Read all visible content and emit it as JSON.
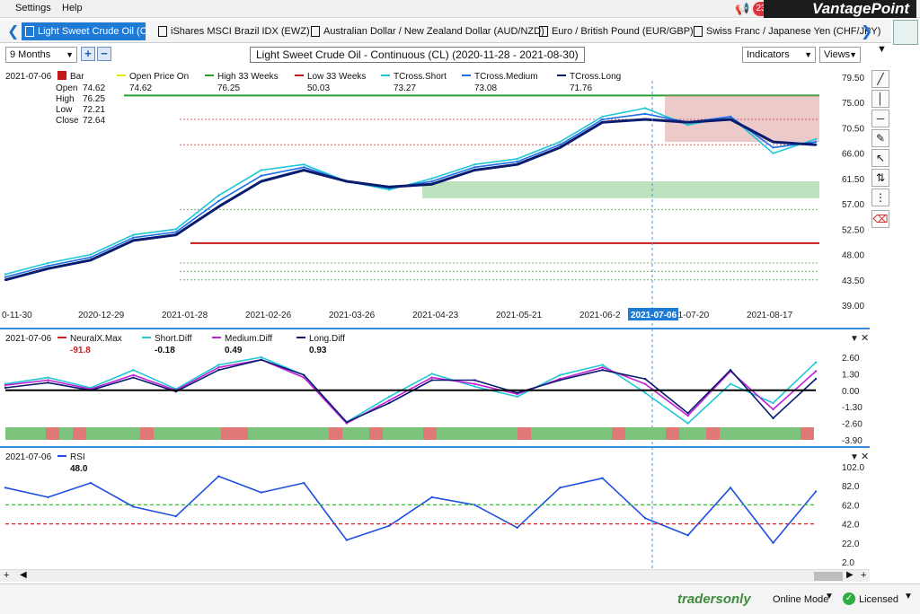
{
  "menu": {
    "settings": "Settings",
    "help": "Help",
    "notifications": "23",
    "brand": "VantagePoint"
  },
  "tabs": [
    {
      "label": "Light Sweet Crude Oil (CL)",
      "active": true
    },
    {
      "label": "iShares MSCI Brazil IDX (EWZ)"
    },
    {
      "label": "Australian Dollar / New Zealand Dollar (AUD/NZD)"
    },
    {
      "label": "Euro / British Pound (EUR/GBP)"
    },
    {
      "label": "Swiss Franc / Japanese Yen (CHF/JPY)"
    }
  ],
  "toolbar": {
    "range": "9 Months",
    "plus": "+",
    "minus": "−",
    "indicators": "Indicators",
    "views": "Views"
  },
  "chart_title": "Light Sweet Crude Oil - Continuous (CL) (2020-11-28 - 2021-08-30)",
  "main_panel": {
    "date": "2021-07-06",
    "bar_label": "Bar",
    "ohlc": [
      {
        "k": "Open",
        "v": "74.62"
      },
      {
        "k": "High",
        "v": "76.25"
      },
      {
        "k": "Low",
        "v": "72.21"
      },
      {
        "k": "Close",
        "v": "72.64"
      }
    ],
    "legend": [
      {
        "name": "Open Price On",
        "value": "74.62",
        "color": "#e8e800"
      },
      {
        "name": "High 33 Weeks",
        "value": "76.25",
        "color": "#2e9e2e"
      },
      {
        "name": "Low 33 Weeks",
        "value": "50.03",
        "color": "#c41818"
      },
      {
        "name": "TCross.Short",
        "value": "73.27",
        "color": "#1fc6d4"
      },
      {
        "name": "TCross.Medium",
        "value": "73.08",
        "color": "#1f6ee8"
      },
      {
        "name": "TCross.Long",
        "value": "71.76",
        "color": "#0a1c6e"
      }
    ],
    "yticks": [
      "79.50",
      "75.00",
      "70.50",
      "66.00",
      "61.50",
      "57.00",
      "52.50",
      "48.00",
      "43.50",
      "39.00"
    ],
    "xticks": [
      "0-11-30",
      "2020-12-29",
      "2021-01-28",
      "2021-02-26",
      "2021-03-26",
      "2021-04-23",
      "2021-05-21",
      "2021-06-2",
      "2021-07-20",
      "2021-08-17"
    ],
    "cursor_date": "2021-07-06"
  },
  "neural_panel": {
    "date": "2021-07-06",
    "legend": [
      {
        "name": "NeuralX.Max",
        "value": "-91.8",
        "color": "#d02020"
      },
      {
        "name": "Short.Diff",
        "value": "-0.18",
        "color": "#20c8d4"
      },
      {
        "name": "Medium.Diff",
        "value": "0.49",
        "color": "#c020d8"
      },
      {
        "name": "Long.Diff",
        "value": "0.93",
        "color": "#0a1c6e"
      }
    ],
    "yticks": [
      "2.60",
      "1.30",
      "0.00",
      "-1.30",
      "-2.60",
      "-3.90"
    ]
  },
  "rsi_panel": {
    "date": "2021-07-06",
    "legend": [
      {
        "name": "RSI",
        "value": "48.0",
        "color": "#1f4fe0"
      }
    ],
    "yticks": [
      "102.0",
      "82.0",
      "62.0",
      "42.0",
      "22.0",
      "2.0"
    ]
  },
  "status": {
    "logo": "tradersonly",
    "online": "Online Mode",
    "licensed": "Licensed"
  },
  "chart_data": [
    {
      "type": "line",
      "title": "Light Sweet Crude Oil - Continuous (CL) (2020-11-28 - 2021-08-30)",
      "ylim": [
        39.0,
        79.5
      ],
      "x": [
        "2020-11-30",
        "2020-12-14",
        "2020-12-29",
        "2021-01-12",
        "2021-01-28",
        "2021-02-12",
        "2021-02-26",
        "2021-03-12",
        "2021-03-26",
        "2021-04-09",
        "2021-04-23",
        "2021-05-07",
        "2021-05-21",
        "2021-06-07",
        "2021-06-21",
        "2021-07-06",
        "2021-07-20",
        "2021-08-03",
        "2021-08-17",
        "2021-08-30"
      ],
      "series": [
        {
          "name": "TCross.Short",
          "values": [
            44.5,
            46.5,
            48.0,
            51.5,
            52.5,
            58.5,
            63.0,
            64.0,
            61.0,
            59.5,
            61.5,
            64.0,
            65.0,
            68.0,
            72.5,
            74.0,
            71.0,
            72.5,
            66.0,
            68.5
          ]
        },
        {
          "name": "TCross.Medium",
          "values": [
            44.0,
            46.0,
            47.5,
            51.0,
            52.0,
            57.5,
            62.0,
            63.5,
            61.0,
            59.8,
            61.0,
            63.5,
            64.5,
            67.5,
            72.0,
            73.0,
            71.5,
            72.5,
            67.0,
            68.0
          ]
        },
        {
          "name": "TCross.Long",
          "values": [
            43.5,
            45.5,
            47.0,
            50.5,
            51.5,
            56.5,
            61.0,
            63.0,
            61.0,
            60.0,
            60.5,
            63.0,
            64.0,
            67.0,
            71.5,
            72.0,
            71.5,
            72.0,
            68.0,
            67.5
          ]
        }
      ]
    },
    {
      "type": "line",
      "ylim": [
        -3.9,
        2.6
      ],
      "x": [
        "2020-11-30",
        "2020-12-14",
        "2020-12-29",
        "2021-01-12",
        "2021-01-28",
        "2021-02-12",
        "2021-02-26",
        "2021-03-12",
        "2021-03-26",
        "2021-04-09",
        "2021-04-23",
        "2021-05-07",
        "2021-05-21",
        "2021-06-07",
        "2021-06-21",
        "2021-07-06",
        "2021-07-20",
        "2021-08-03",
        "2021-08-17",
        "2021-08-30"
      ],
      "series": [
        {
          "name": "Short.Diff",
          "values": [
            0.5,
            1.0,
            0.2,
            1.6,
            0.1,
            2.0,
            2.6,
            1.2,
            -2.5,
            -0.5,
            1.3,
            0.3,
            -0.5,
            1.2,
            2.0,
            -0.2,
            -2.6,
            0.5,
            -1.0,
            2.2
          ]
        },
        {
          "name": "Medium.Diff",
          "values": [
            0.4,
            0.8,
            0.1,
            1.2,
            0.0,
            1.8,
            2.4,
            1.0,
            -2.6,
            -0.8,
            1.0,
            0.5,
            -0.3,
            0.9,
            1.8,
            0.5,
            -2.0,
            1.5,
            -1.5,
            1.5
          ]
        },
        {
          "name": "Long.Diff",
          "values": [
            0.2,
            0.6,
            0.0,
            1.0,
            -0.1,
            1.6,
            2.4,
            1.2,
            -2.5,
            -1.0,
            0.8,
            0.8,
            -0.2,
            0.8,
            1.6,
            0.9,
            -1.8,
            1.6,
            -2.2,
            0.9
          ]
        }
      ]
    },
    {
      "type": "line",
      "ylim": [
        2.0,
        102.0
      ],
      "x": [
        "2020-11-30",
        "2020-12-14",
        "2020-12-29",
        "2021-01-12",
        "2021-01-28",
        "2021-02-12",
        "2021-02-26",
        "2021-03-12",
        "2021-03-26",
        "2021-04-09",
        "2021-04-23",
        "2021-05-07",
        "2021-05-21",
        "2021-06-07",
        "2021-06-21",
        "2021-07-06",
        "2021-07-20",
        "2021-08-03",
        "2021-08-17",
        "2021-08-30"
      ],
      "series": [
        {
          "name": "RSI",
          "values": [
            80,
            70,
            85,
            60,
            50,
            92,
            75,
            85,
            25,
            40,
            70,
            62,
            38,
            80,
            90,
            48,
            30,
            80,
            22,
            76
          ]
        }
      ]
    }
  ]
}
